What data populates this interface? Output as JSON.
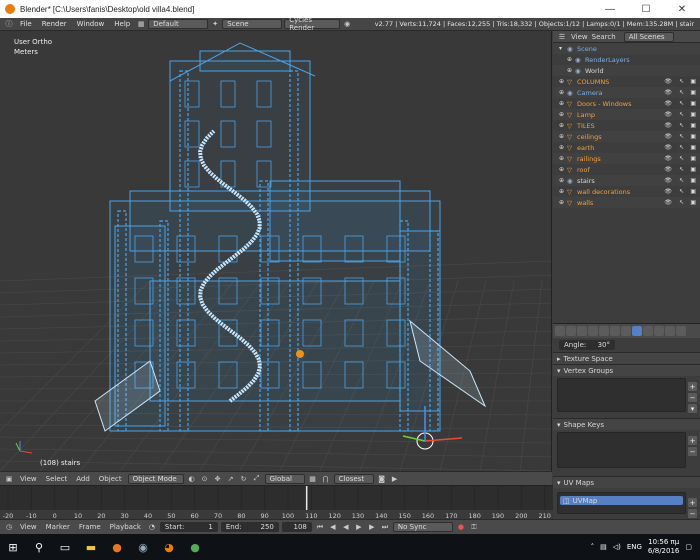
{
  "window": {
    "title": "Blender* [C:\\Users\\fanis\\Desktop\\old villa4.blend]",
    "min": "—",
    "max": "☐",
    "close": "✕"
  },
  "info": {
    "menus": [
      "File",
      "Render",
      "Window",
      "Help"
    ],
    "layout": "Default",
    "scene": "Scene",
    "engine": "Cycles Render",
    "stats": "v2.77 | Verts:11,724 | Faces:12,255 | Tris:18,332 | Objects:1/12 | Lamps:0/1 | Mem:135.28M | stair"
  },
  "viewport": {
    "view_name": "User Ortho",
    "units": "Meters",
    "selection": "(108) stairs"
  },
  "view3d_header": {
    "menus": [
      "View",
      "Select",
      "Add",
      "Object"
    ],
    "mode": "Object Mode",
    "orientation": "Global",
    "snap": "Closest"
  },
  "outliner": {
    "menus": [
      "View",
      "Search"
    ],
    "filter": "All Scenes",
    "items": [
      {
        "label": "Scene",
        "color": "blue"
      },
      {
        "label": "RenderLayers",
        "color": "blue"
      },
      {
        "label": "World",
        "color": "white"
      },
      {
        "label": "COLUMNS",
        "color": "orange"
      },
      {
        "label": "Camera",
        "color": "blue"
      },
      {
        "label": "Doors - Windows",
        "color": "orange"
      },
      {
        "label": "Lamp",
        "color": "orange"
      },
      {
        "label": "TILES",
        "color": "orange"
      },
      {
        "label": "ceilings",
        "color": "orange"
      },
      {
        "label": "earth",
        "color": "orange"
      },
      {
        "label": "railings",
        "color": "orange"
      },
      {
        "label": "roof",
        "color": "orange"
      },
      {
        "label": "stairs",
        "color": "white"
      },
      {
        "label": "wall decorations",
        "color": "orange"
      },
      {
        "label": "walls",
        "color": "orange"
      }
    ]
  },
  "properties": {
    "angle_label": "Angle:",
    "angle_value": "30°",
    "panels": [
      "Texture Space",
      "Vertex Groups",
      "Shape Keys",
      "UV Maps"
    ],
    "uvmap_name": "UVMap"
  },
  "timeline": {
    "ticks": [
      "-20",
      "-10",
      "0",
      "10",
      "20",
      "30",
      "40",
      "50",
      "60",
      "70",
      "80",
      "90",
      "100",
      "110",
      "120",
      "130",
      "140",
      "150",
      "160",
      "170",
      "180",
      "190",
      "200",
      "210",
      "220",
      "230",
      "240",
      "250",
      "260",
      "270"
    ],
    "menus": [
      "View",
      "Marker",
      "Frame",
      "Playback"
    ],
    "start_label": "Start:",
    "start": "1",
    "end_label": "End:",
    "end": "250",
    "current": "108",
    "sync": "No Sync"
  },
  "taskbar": {
    "language": "ENG",
    "time": "10:56 πμ",
    "date": "6/8/2016"
  },
  "colors": {
    "wire": "#4aa3e8",
    "wire_light": "#c8e8ff",
    "bg": "#393939",
    "accent": "#e87d0d"
  }
}
